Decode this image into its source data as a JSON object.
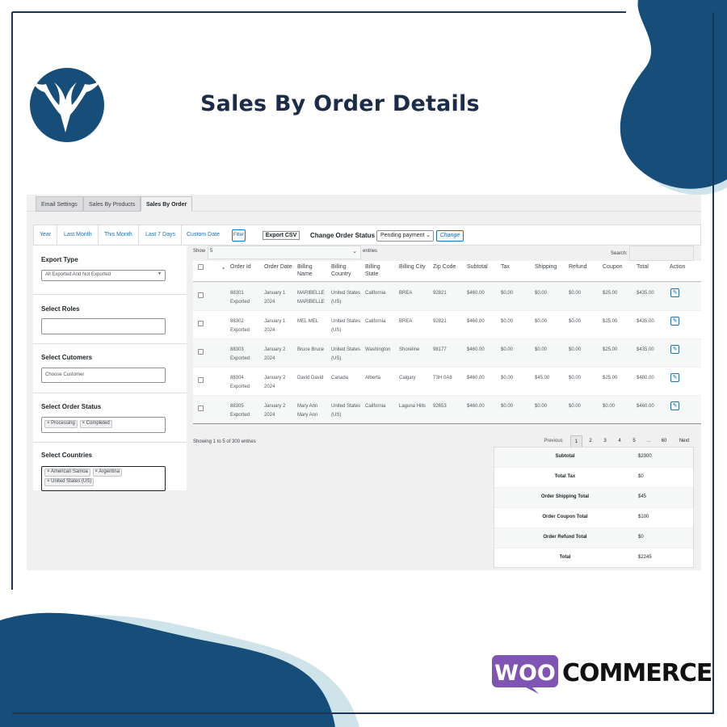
{
  "header": {
    "title": "Sales By Order Details"
  },
  "colors": {
    "brand_navy": "#164e79",
    "brand_light": "#cfe3ea",
    "woo_purple": "#7f54b3",
    "link_blue": "#2271b1"
  },
  "top_tabs": [
    {
      "label": "Email Settings"
    },
    {
      "label": "Sales By Products"
    },
    {
      "label": "Sales By Order"
    }
  ],
  "filter_tabs": [
    "Year",
    "Last Month",
    "This Month",
    "Last 7 Days",
    "Custom Date"
  ],
  "filter_button": "Filter",
  "export_button": "Export CSV",
  "order_status": {
    "label": "Change Order Status",
    "selected": "Pending payment",
    "change_button": "Change"
  },
  "sidebar": {
    "export_type": {
      "title": "Export Type",
      "selected": "All Exported And Not Exported"
    },
    "roles": {
      "title": "Select Roles"
    },
    "customers": {
      "title": "Select Cutomers",
      "placeholder": "Choose Customer"
    },
    "order_status": {
      "title": "Select Order Status",
      "chips": [
        "Processing",
        "Completed"
      ]
    },
    "countries": {
      "title": "Select Countries",
      "chips": [
        "American Samoa",
        "Argentina",
        "United States (US)"
      ]
    }
  },
  "table_controls": {
    "show_label": "Show",
    "entries_value": "5",
    "entries_label": "entries",
    "search_label": "Search:"
  },
  "table": {
    "columns": [
      "Order Id",
      "Order Date",
      "Billing Name",
      "Billing Country",
      "Billing State",
      "Billing City",
      "Zip Code",
      "Subtotal",
      "Tax",
      "Shipping",
      "Refund",
      "Coupon",
      "Total",
      "Action"
    ],
    "rows": [
      {
        "order_id": "88301 Exported",
        "date": "January 1 2024",
        "name": "MARIBELLE MARIBELLE",
        "country": "United States (US)",
        "state": "California",
        "city": "BREA",
        "zip": "92821",
        "subtotal": "$460.00",
        "tax": "$0.00",
        "shipping": "$0.00",
        "refund": "$0.00",
        "coupon": "$25.00",
        "total": "$435.00"
      },
      {
        "order_id": "88302 Exported",
        "date": "January 1 2024",
        "name": "MEL MEL",
        "country": "United States (US)",
        "state": "California",
        "city": "BREA",
        "zip": "92821",
        "subtotal": "$460.00",
        "tax": "$0.00",
        "shipping": "$0.00",
        "refund": "$0.00",
        "coupon": "$25.00",
        "total": "$435.00"
      },
      {
        "order_id": "88303 Exported",
        "date": "January 2 2024",
        "name": "Bruce Bruce",
        "country": "United States (US)",
        "state": "Washington",
        "city": "Shoreline",
        "zip": "98177",
        "subtotal": "$460.00",
        "tax": "$0.00",
        "shipping": "$0.00",
        "refund": "$0.00",
        "coupon": "$25.00",
        "total": "$435.00"
      },
      {
        "order_id": "88304 Exported",
        "date": "January 2 2024",
        "name": "David David",
        "country": "Canada",
        "state": "Alberta",
        "city": "Calgary",
        "zip": "T3H 0A8",
        "subtotal": "$460.00",
        "tax": "$0.00",
        "shipping": "$45.00",
        "refund": "$0.00",
        "coupon": "$25.00",
        "total": "$480.00"
      },
      {
        "order_id": "88305 Exported",
        "date": "January 2 2024",
        "name": "Mary Ann Mary Ann",
        "country": "United States (US)",
        "state": "California",
        "city": "Laguna Hills",
        "zip": "92653",
        "subtotal": "$460.00",
        "tax": "$0.00",
        "shipping": "$0.00",
        "refund": "$0.00",
        "coupon": "$0.00",
        "total": "$460.00"
      }
    ]
  },
  "table_info": "Showing 1 to 5 of 300 entries",
  "pagination": [
    "Previous",
    "1",
    "2",
    "3",
    "4",
    "5",
    "...",
    "60",
    "Next"
  ],
  "summary": [
    {
      "label": "Subtotal",
      "value": "$2300"
    },
    {
      "label": "Total Tax",
      "value": "$0"
    },
    {
      "label": "Order Shipping Total",
      "value": "$45"
    },
    {
      "label": "Order Coupon Total",
      "value": "$100"
    },
    {
      "label": "Order Refund Total",
      "value": "$0"
    },
    {
      "label": "Total",
      "value": "$2245"
    }
  ],
  "footer": {
    "woo_text": "WOO",
    "commerce_text": "COMMERCE"
  }
}
